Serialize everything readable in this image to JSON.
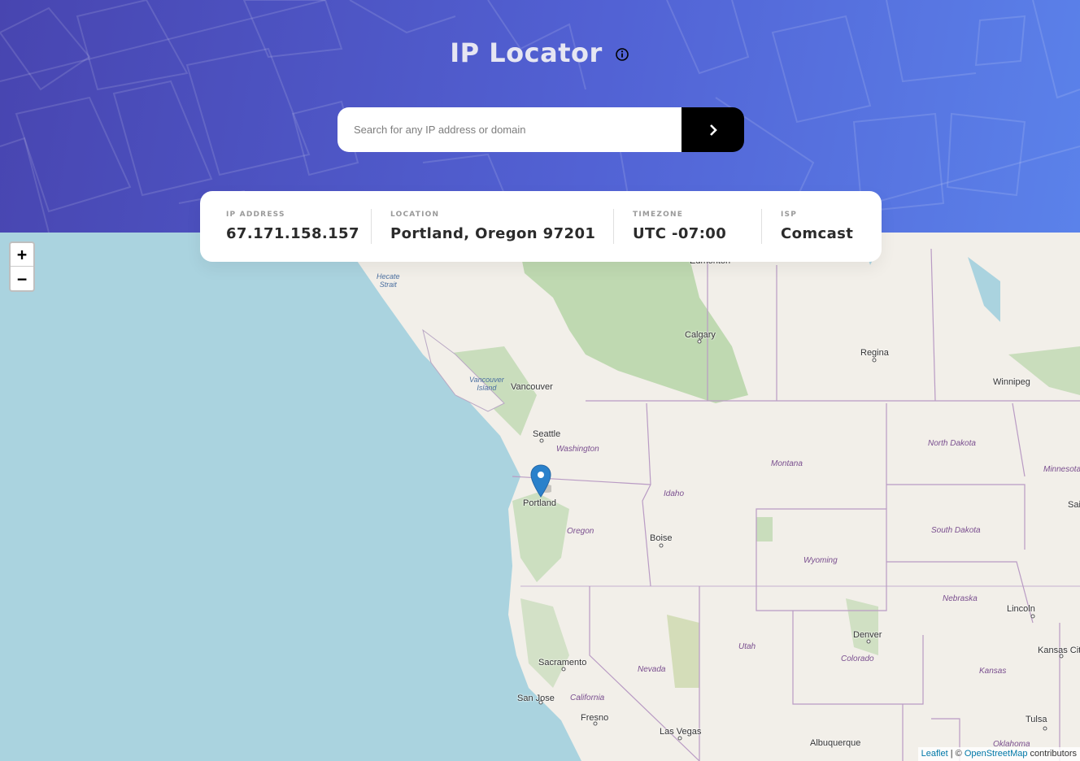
{
  "header": {
    "title": "IP Locator",
    "info_icon": "info-icon"
  },
  "search": {
    "placeholder": "Search for any IP address or domain",
    "value": "",
    "submit_icon": "chevron-right-icon"
  },
  "stats": [
    {
      "label": "IP ADDRESS",
      "value": "67.171.158.157"
    },
    {
      "label": "LOCATION",
      "value": "Portland, Oregon 97201"
    },
    {
      "label": "TIMEZONE",
      "value": "UTC -07:00"
    },
    {
      "label": "ISP",
      "value": "Comcast"
    }
  ],
  "map": {
    "zoom_in": "+",
    "zoom_out": "−",
    "marker_icon": "location-pin-icon",
    "attribution": {
      "leaflet": "Leaflet",
      "separator": " | © ",
      "osm": "OpenStreetMap",
      "suffix": " contributors"
    },
    "cities": [
      "Edmonton",
      "Calgary",
      "Regina",
      "Winnipeg",
      "Vancouver",
      "Seattle",
      "Portland",
      "Boise",
      "Denver",
      "Lincoln",
      "Kansas Cit",
      "Sacramento",
      "San Jose",
      "Fresno",
      "Las Vegas",
      "Albuquerque",
      "Tulsa",
      "Sai"
    ],
    "regions": [
      "Washington",
      "Montana",
      "North Dakota",
      "Minnesota",
      "Idaho",
      "Oregon",
      "South Dakota",
      "Wyoming",
      "Nebraska",
      "Utah",
      "Colorado",
      "Nevada",
      "Kansas",
      "California",
      "Oklahoma"
    ],
    "water": [
      "Hecate\nStrait",
      "Vancouver\nIsland"
    ]
  },
  "colors": {
    "header_start": "#4845b0",
    "header_end": "#5b82ea",
    "water": "#aad3df",
    "land": "#f2efe9",
    "forest": "#add19e",
    "button": "#000000"
  }
}
